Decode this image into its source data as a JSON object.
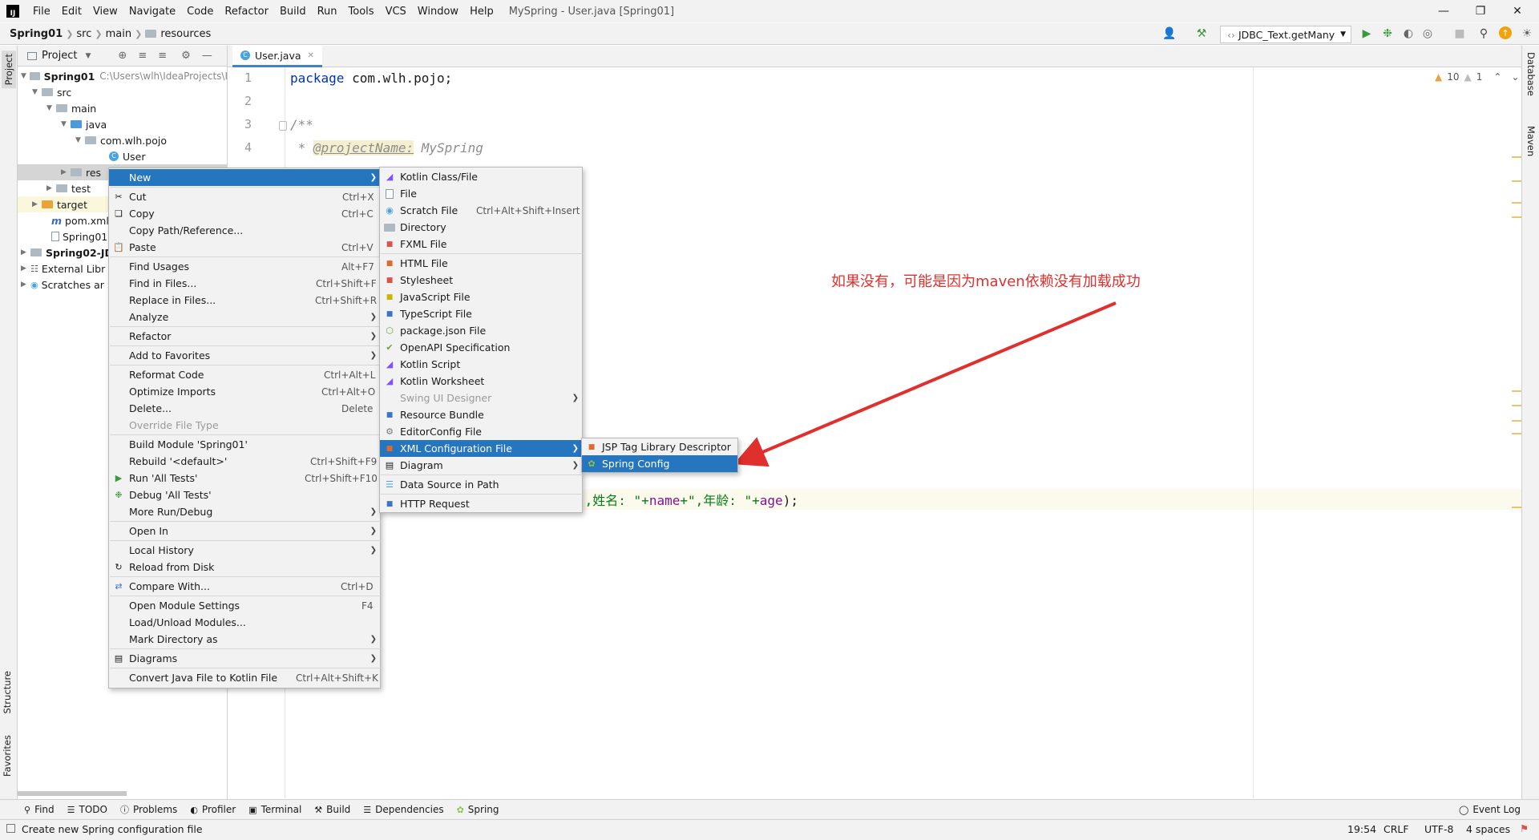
{
  "window": {
    "title": "MySpring - User.java [Spring01]",
    "logo": "IJ"
  },
  "menubar": [
    "File",
    "Edit",
    "View",
    "Navigate",
    "Code",
    "Refactor",
    "Build",
    "Run",
    "Tools",
    "VCS",
    "Window",
    "Help"
  ],
  "breadcrumb": {
    "project": "Spring01",
    "p1": "src",
    "p2": "main",
    "p3": "resources"
  },
  "toolbar": {
    "run_config": "JDBC_Text.getMany"
  },
  "left_tabs": {
    "project": "Project",
    "structure": "Structure",
    "favorites": "Favorites"
  },
  "right_tabs": {
    "database": "Database",
    "maven": "Maven"
  },
  "project_panel": {
    "title": "Project",
    "tree": [
      {
        "label": "Spring01",
        "extra": "C:\\Users\\wlh\\IdeaProjects\\I"
      },
      {
        "label": "src"
      },
      {
        "label": "main"
      },
      {
        "label": "java"
      },
      {
        "label": "com.wlh.pojo"
      },
      {
        "label": "User"
      },
      {
        "label": "res"
      },
      {
        "label": "test"
      },
      {
        "label": "target"
      },
      {
        "label": "pom.xml"
      },
      {
        "label": "Spring01"
      },
      {
        "label": "Spring02-JD"
      },
      {
        "label": "External Libr"
      },
      {
        "label": "Scratches ar"
      }
    ]
  },
  "editor": {
    "tab": "User.java",
    "inspections": {
      "warnings": "10",
      "weak": "1"
    },
    "lines": [
      "1",
      "2",
      "3",
      "4"
    ],
    "code": {
      "line1_kw": "package",
      "line1_rest": " com.wlh.pojo;",
      "line3": "/**",
      "line4_star": " * ",
      "line4_tag": "@projectName:",
      "line4_val": " MySpring",
      "tostring_a": "\",姓名: \"+",
      "tostring_name": "name",
      "tostring_b": "+\",年龄: \"+",
      "tostring_age": "age",
      "tostring_c": ");"
    }
  },
  "context_menu": [
    {
      "label": "New",
      "shortcut": "",
      "sub": true
    },
    {
      "label": "Cut",
      "shortcut": "Ctrl+X"
    },
    {
      "label": "Copy",
      "shortcut": "Ctrl+C"
    },
    {
      "label": "Copy Path/Reference...",
      "shortcut": ""
    },
    {
      "label": "Paste",
      "shortcut": "Ctrl+V"
    },
    {
      "label": "Find Usages",
      "shortcut": "Alt+F7"
    },
    {
      "label": "Find in Files...",
      "shortcut": "Ctrl+Shift+F"
    },
    {
      "label": "Replace in Files...",
      "shortcut": "Ctrl+Shift+R"
    },
    {
      "label": "Analyze",
      "shortcut": "",
      "sub": true
    },
    {
      "label": "Refactor",
      "shortcut": "",
      "sub": true
    },
    {
      "label": "Add to Favorites",
      "shortcut": "",
      "sub": true
    },
    {
      "label": "Reformat Code",
      "shortcut": "Ctrl+Alt+L"
    },
    {
      "label": "Optimize Imports",
      "shortcut": "Ctrl+Alt+O"
    },
    {
      "label": "Delete...",
      "shortcut": "Delete"
    },
    {
      "label": "Override File Type",
      "shortcut": ""
    },
    {
      "label": "Build Module 'Spring01'",
      "shortcut": ""
    },
    {
      "label": "Rebuild '<default>'",
      "shortcut": "Ctrl+Shift+F9"
    },
    {
      "label": "Run 'All Tests'",
      "shortcut": "Ctrl+Shift+F10"
    },
    {
      "label": "Debug 'All Tests'",
      "shortcut": ""
    },
    {
      "label": "More Run/Debug",
      "shortcut": "",
      "sub": true
    },
    {
      "label": "Open In",
      "shortcut": "",
      "sub": true
    },
    {
      "label": "Local History",
      "shortcut": "",
      "sub": true
    },
    {
      "label": "Reload from Disk",
      "shortcut": ""
    },
    {
      "label": "Compare With...",
      "shortcut": "Ctrl+D"
    },
    {
      "label": "Open Module Settings",
      "shortcut": "F4"
    },
    {
      "label": "Load/Unload Modules...",
      "shortcut": ""
    },
    {
      "label": "Mark Directory as",
      "shortcut": "",
      "sub": true
    },
    {
      "label": "Diagrams",
      "shortcut": "",
      "sub": true
    },
    {
      "label": "Convert Java File to Kotlin File",
      "shortcut": "Ctrl+Alt+Shift+K"
    }
  ],
  "new_submenu": [
    {
      "label": "Kotlin Class/File",
      "shortcut": ""
    },
    {
      "label": "File",
      "shortcut": ""
    },
    {
      "label": "Scratch File",
      "shortcut": "Ctrl+Alt+Shift+Insert"
    },
    {
      "label": "Directory",
      "shortcut": ""
    },
    {
      "label": "FXML File",
      "shortcut": ""
    },
    {
      "label": "HTML File",
      "shortcut": ""
    },
    {
      "label": "Stylesheet",
      "shortcut": ""
    },
    {
      "label": "JavaScript File",
      "shortcut": ""
    },
    {
      "label": "TypeScript File",
      "shortcut": ""
    },
    {
      "label": "package.json File",
      "shortcut": ""
    },
    {
      "label": "OpenAPI Specification",
      "shortcut": ""
    },
    {
      "label": "Kotlin Script",
      "shortcut": ""
    },
    {
      "label": "Kotlin Worksheet",
      "shortcut": ""
    },
    {
      "label": "Swing UI Designer",
      "shortcut": ""
    },
    {
      "label": "Resource Bundle",
      "shortcut": ""
    },
    {
      "label": "EditorConfig File",
      "shortcut": ""
    },
    {
      "label": "XML Configuration File",
      "shortcut": ""
    },
    {
      "label": "Diagram",
      "shortcut": ""
    },
    {
      "label": "Data Source in Path",
      "shortcut": ""
    },
    {
      "label": "HTTP Request",
      "shortcut": ""
    }
  ],
  "xml_submenu": [
    {
      "label": "JSP Tag Library Descriptor"
    },
    {
      "label": "Spring Config"
    }
  ],
  "annotation": "如果没有，可能是因为maven依赖没有加载成功",
  "bottom_tools": [
    "Find",
    "TODO",
    "Problems",
    "Profiler",
    "Terminal",
    "Build",
    "Dependencies",
    "Spring"
  ],
  "event_log": "Event Log",
  "status": {
    "message": "Create new Spring configuration file",
    "position": "19:54",
    "line_sep": "CRLF",
    "encoding": "UTF-8",
    "indent": "4 spaces"
  },
  "colors": {
    "selection": "#2675bf",
    "annotation": "#e0302e",
    "accent": "#4083c9"
  }
}
